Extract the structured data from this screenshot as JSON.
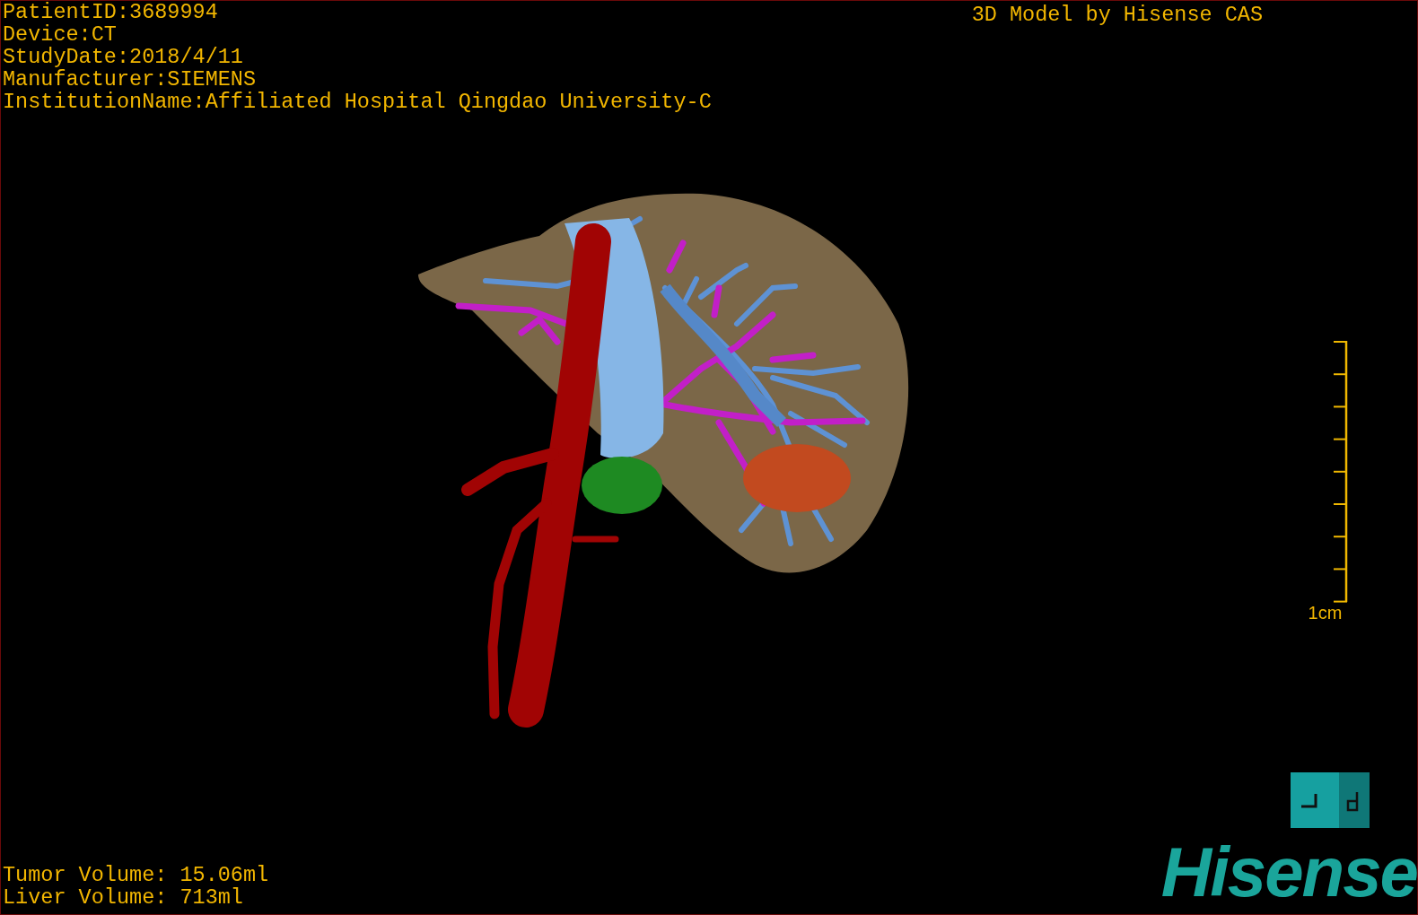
{
  "info_lines": [
    "PatientID:3689994",
    "Device:CT",
    "StudyDate:2018/4/11",
    "Manufacturer:SIEMENS",
    "InstitutionName:Affiliated Hospital Qingdao University-C"
  ],
  "title": "3D Model by Hisense CAS",
  "scale": {
    "label": "1cm"
  },
  "volumes": [
    "Tumor Volume: 15.06ml",
    "Liver Volume: 713ml"
  ],
  "logo": {
    "text": "Hisense"
  }
}
